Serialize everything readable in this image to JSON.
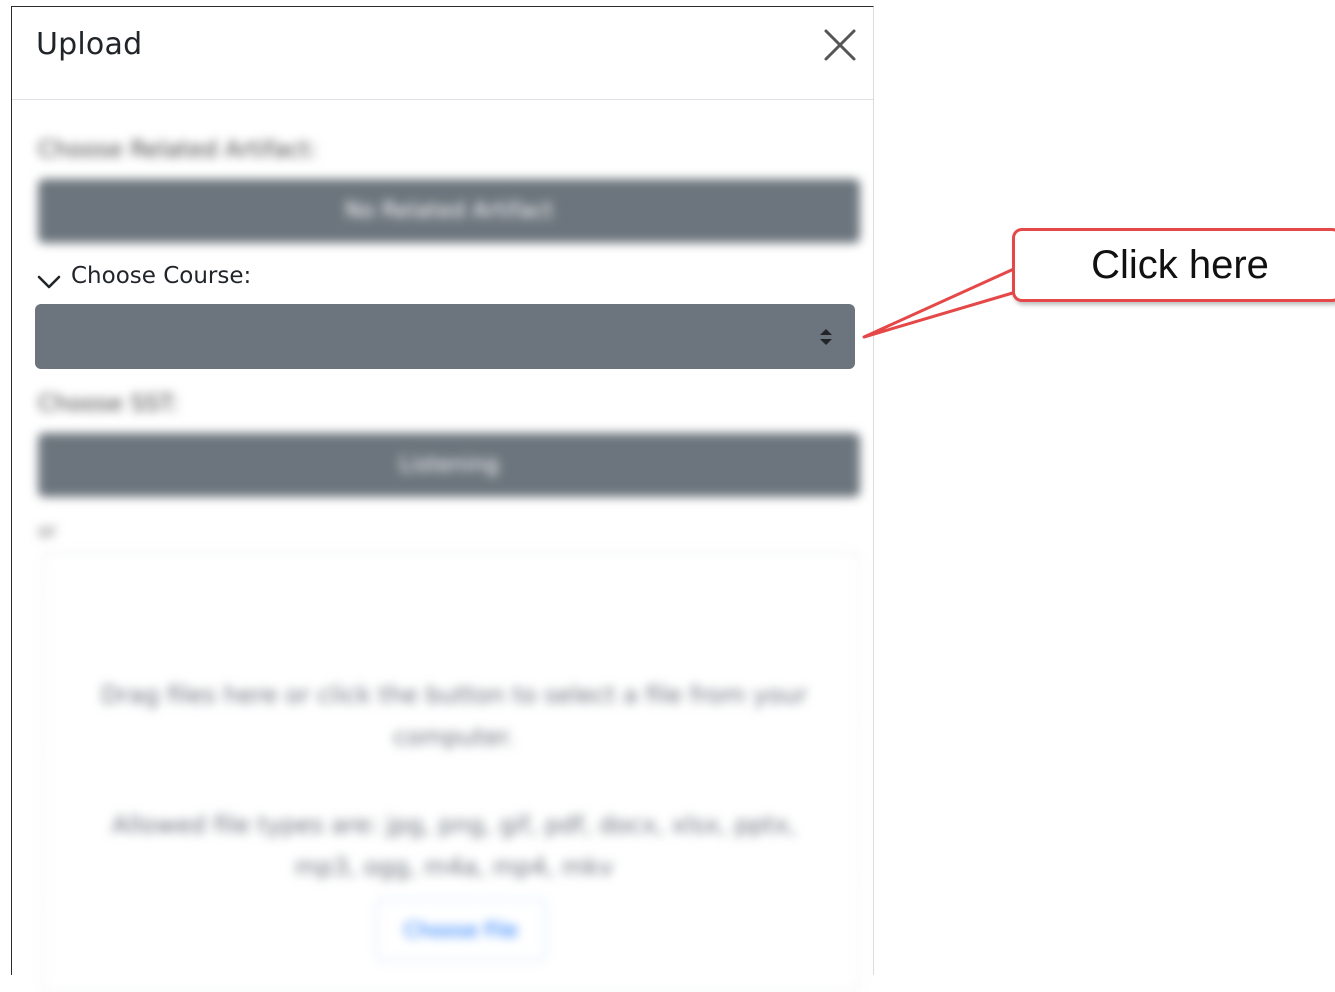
{
  "panel": {
    "title": "Upload",
    "close_icon": "close-icon"
  },
  "fields": {
    "related_artifact": {
      "label": "Choose Related Artifact:",
      "value": "No Related Artifact"
    },
    "course": {
      "label": "Choose Course:",
      "value": ""
    },
    "sst": {
      "label": "Choose SST:",
      "value": "Listening"
    }
  },
  "dropzone": {
    "label": "or",
    "instruction": "Drag files here or click the button to select a file from your computer.",
    "allowed": "Allowed file types are: jpg, png, gif, pdf, docx, xlsx, pptx, mp3, ogg, m4a, mp4, mkv",
    "button_label": "Choose File"
  },
  "callout": {
    "text": "Click here"
  },
  "colors": {
    "select_bg": "#6c757d",
    "callout_border": "#e54848",
    "text": "#212529"
  }
}
